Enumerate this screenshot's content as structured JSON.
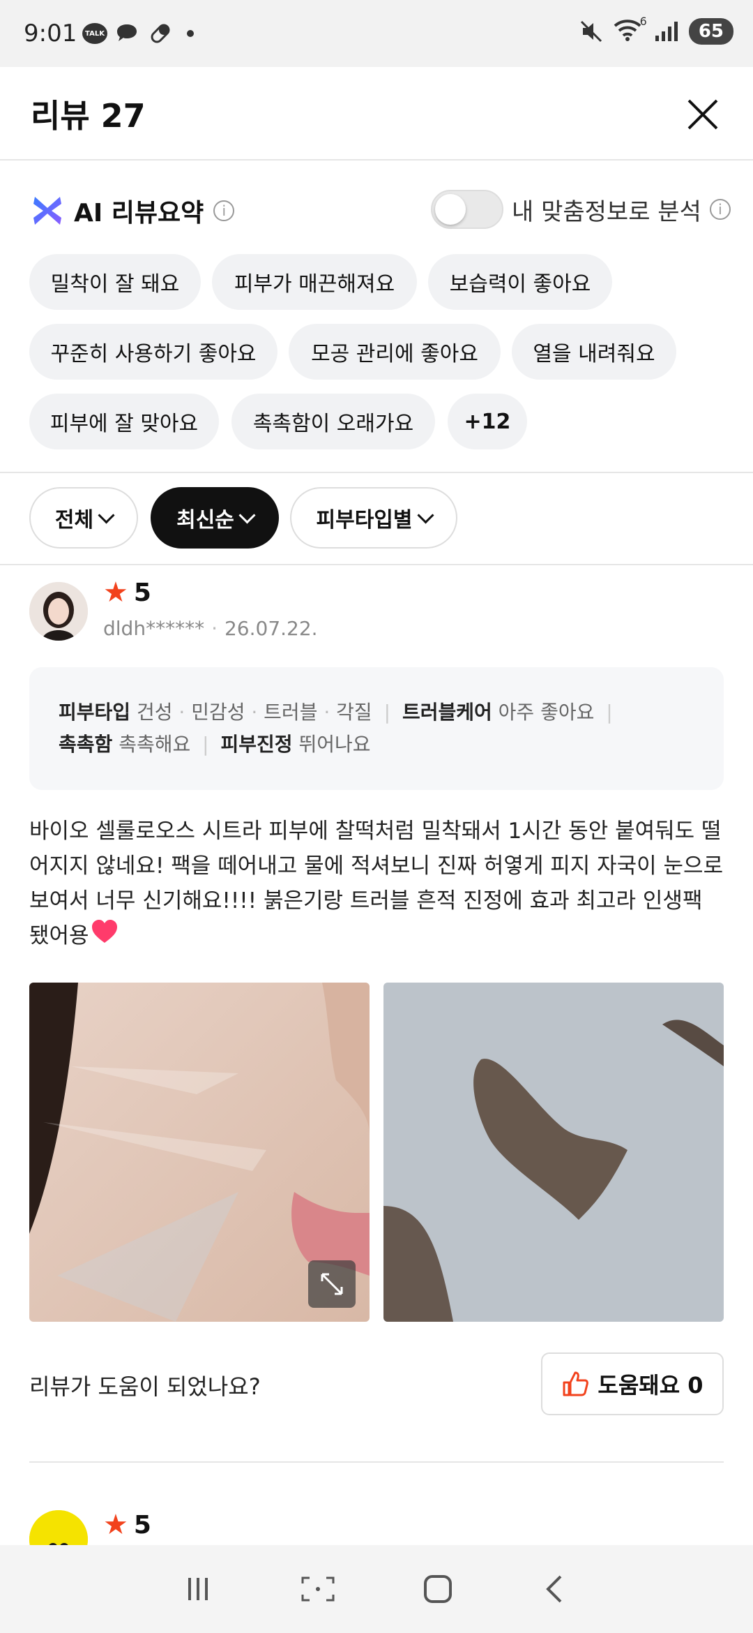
{
  "status_bar": {
    "time": "9:01",
    "talk_badge": "TALK",
    "wifi_badge": "6",
    "battery": "65"
  },
  "header": {
    "title": "리뷰 27"
  },
  "ai_summary": {
    "title": "AI 리뷰요약",
    "toggle_label": "내 맞춤정보로 분석",
    "toggle_on": false,
    "chips": [
      "밀착이 잘 돼요",
      "피부가 매끈해져요",
      "보습력이 좋아요",
      "꾸준히 사용하기 좋아요",
      "모공 관리에 좋아요",
      "열을 내려줘요",
      "피부에 잘 맞아요",
      "촉촉함이 오래가요",
      "+12"
    ]
  },
  "filters": [
    {
      "label": "전체",
      "active": false
    },
    {
      "label": "최신순",
      "active": true
    },
    {
      "label": "피부타입별",
      "active": false
    }
  ],
  "review": {
    "rating": "5",
    "user": "dldh******",
    "date": "26.07.22.",
    "skin_type_label": "피부타입",
    "skin_types": [
      "건성",
      "민감성",
      "트러블",
      "각질"
    ],
    "trouble_care_label": "트러블케어",
    "trouble_care_value": "아주 좋아요",
    "moisture_label": "촉촉함",
    "moisture_value": "촉촉해요",
    "soothing_label": "피부진정",
    "soothing_value": "뛰어나요",
    "text": "바이오 셀룰로오스 시트라 피부에 찰떡처럼 밀착돼서 1시간 동안 붙여둬도 떨어지지 않네요! 팩을 떼어내고 물에 적셔보니 진짜 허옇게 피지 자국이 눈으로 보여서 너무 신기해요!!!! 붉은기랑 트러블 흔적 진정에 효과 최고라 인생팩 됐어용",
    "helpful_question": "리뷰가 도움이 되었나요?",
    "helpful_button": "도움돼요 0"
  },
  "next_review": {
    "rating": "5"
  },
  "colors": {
    "star": "#f2421c",
    "active_filter": "#111111",
    "chip_bg": "#f1f2f4",
    "heart": "#ff3b6b"
  }
}
